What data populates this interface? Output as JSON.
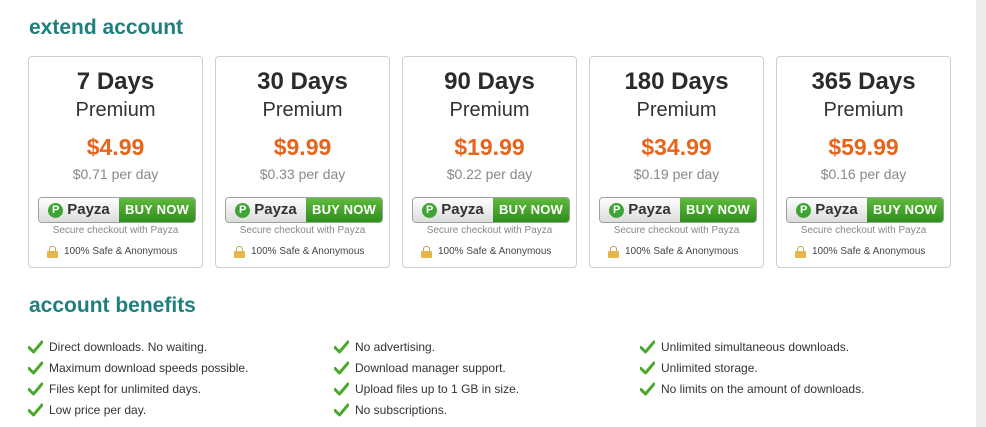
{
  "extend_title": "extend account",
  "plans": [
    {
      "days": "7 Days",
      "tier": "Premium",
      "price": "$4.99",
      "per_day": "$0.71 per day"
    },
    {
      "days": "30 Days",
      "tier": "Premium",
      "price": "$9.99",
      "per_day": "$0.33 per day"
    },
    {
      "days": "90 Days",
      "tier": "Premium",
      "price": "$19.99",
      "per_day": "$0.22 per day"
    },
    {
      "days": "180 Days",
      "tier": "Premium",
      "price": "$34.99",
      "per_day": "$0.19 per day"
    },
    {
      "days": "365 Days",
      "tier": "Premium",
      "price": "$59.99",
      "per_day": "$0.16 per day"
    }
  ],
  "payment": {
    "brand": "Payza",
    "buy_label": "BUY NOW",
    "secure_note": "Secure checkout with Payza",
    "safe_label": "100% Safe & Anonymous"
  },
  "benefits_title": "account benefits",
  "benefits": [
    [
      "Direct downloads. No waiting.",
      "Maximum download speeds possible.",
      "Files kept for unlimited days.",
      "Low price per day."
    ],
    [
      "No advertising.",
      "Download manager support.",
      "Upload files up to 1 GB in size.",
      "No subscriptions."
    ],
    [
      "Unlimited simultaneous downloads.",
      "Unlimited storage.",
      "No limits on the amount of downloads."
    ]
  ],
  "colors": {
    "title": "#1f7f7f",
    "price": "#e8641b",
    "buy_green": "#3c9a26",
    "check_green": "#4aa82c"
  }
}
